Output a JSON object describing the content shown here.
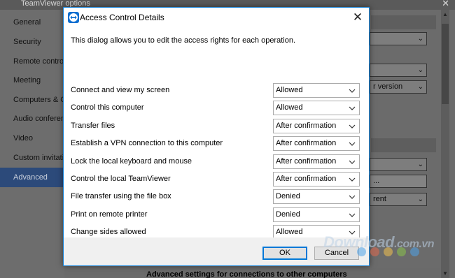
{
  "background": {
    "title": "TeamViewer options",
    "nav_items": [
      {
        "label": "General"
      },
      {
        "label": "Security"
      },
      {
        "label": "Remote control"
      },
      {
        "label": "Meeting"
      },
      {
        "label": "Computers & Co"
      },
      {
        "label": "Audio conferenc"
      },
      {
        "label": "Video"
      },
      {
        "label": "Custom invitatio"
      },
      {
        "label": "Advanced",
        "active": true
      }
    ],
    "combo_fragment_version": "r version",
    "button_fragment_dots": "...",
    "combo_fragment_rent": "rent",
    "bottom_header": "Advanced settings for connections to other computers"
  },
  "dialog": {
    "title": "Access Control Details",
    "description": "This dialog allows you to edit the access rights for each operation.",
    "permissions": [
      {
        "label": "Connect and view my screen",
        "value": "Allowed"
      },
      {
        "label": "Control this computer",
        "value": "Allowed"
      },
      {
        "label": "Transfer files",
        "value": "After confirmation"
      },
      {
        "label": "Establish a VPN connection to this computer",
        "value": "After confirmation"
      },
      {
        "label": "Lock the local keyboard and mouse",
        "value": "After confirmation"
      },
      {
        "label": "Control the local TeamViewer",
        "value": "After confirmation"
      },
      {
        "label": "File transfer using the file box",
        "value": "Denied"
      },
      {
        "label": "Print on remote printer",
        "value": "Denied"
      },
      {
        "label": "Change sides allowed",
        "value": "Allowed"
      }
    ],
    "ok_label": "OK",
    "cancel_label": "Cancel"
  },
  "watermark": {
    "text": "Download",
    "suffix": ".com.vn",
    "dot_colors": [
      "#4ea3e8",
      "#e26a4f",
      "#f2c14e",
      "#8bc34a",
      "#4ea3e8"
    ]
  },
  "colors": {
    "accent": "#0078d7",
    "active_nav": "#2c4a7a",
    "teamviewer_blue": "#0e6fd0"
  },
  "icons": {
    "app": "teamviewer-logo-icon",
    "close": "close-icon",
    "dropdown": "chevron-down-icon"
  }
}
